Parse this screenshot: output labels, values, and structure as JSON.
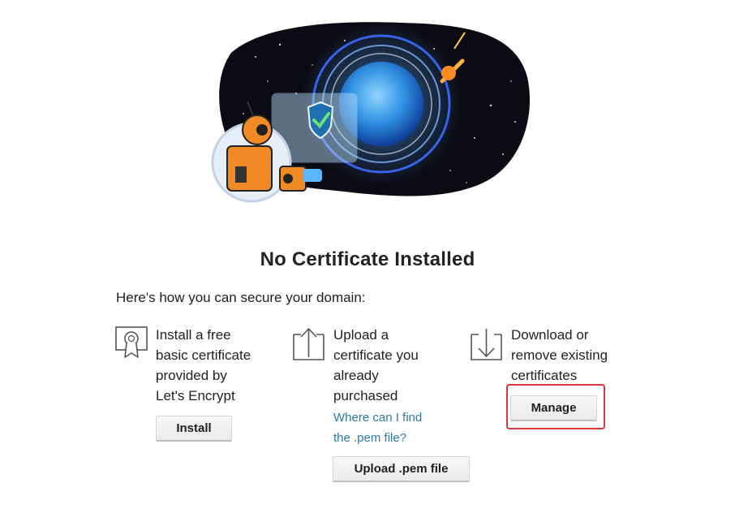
{
  "title": "No Certificate Installed",
  "subtitle": "Here's how you can secure your domain:",
  "options": [
    {
      "icon": "certificate-icon",
      "lines": [
        "Install a free",
        "basic certificate",
        "provided by",
        "Let's Encrypt"
      ],
      "button": "Install"
    },
    {
      "icon": "upload-icon",
      "lines": [
        "Upload a",
        "certificate you",
        "already",
        "purchased"
      ],
      "link_lines": [
        "Where can I find",
        "the .pem file?"
      ],
      "button": "Upload .pem file"
    },
    {
      "icon": "download-icon",
      "lines": [
        "Download or",
        "remove existing",
        "certificates"
      ],
      "button": "Manage"
    }
  ],
  "colors": {
    "link": "#2a7ba8",
    "highlight": "#d9363e",
    "robot_orange": "#f08a24",
    "space": "#0b0b14"
  }
}
